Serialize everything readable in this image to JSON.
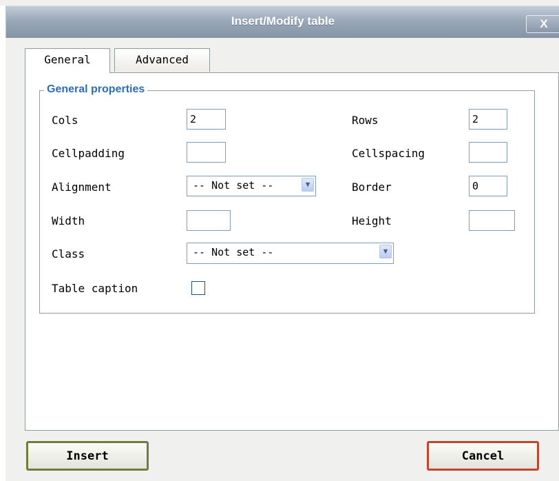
{
  "window": {
    "title": "Insert/Modify table",
    "close_label": "X"
  },
  "tabs": [
    {
      "label": "General",
      "active": true
    },
    {
      "label": "Advanced",
      "active": false
    }
  ],
  "general": {
    "legend": "General properties",
    "cols": {
      "label": "Cols",
      "value": "2"
    },
    "rows": {
      "label": "Rows",
      "value": "2"
    },
    "cellpadding": {
      "label": "Cellpadding",
      "value": ""
    },
    "cellspacing": {
      "label": "Cellspacing",
      "value": ""
    },
    "alignment": {
      "label": "Alignment",
      "value": "-- Not set --"
    },
    "border": {
      "label": "Border",
      "value": "0"
    },
    "width": {
      "label": "Width",
      "value": ""
    },
    "height": {
      "label": "Height",
      "value": ""
    },
    "class": {
      "label": "Class",
      "value": "-- Not set --"
    },
    "caption": {
      "label": "Table caption",
      "checked": false
    }
  },
  "buttons": {
    "insert": "Insert",
    "cancel": "Cancel"
  },
  "icons": {
    "close": "close-icon",
    "dropdown": "chevron-down-icon"
  }
}
